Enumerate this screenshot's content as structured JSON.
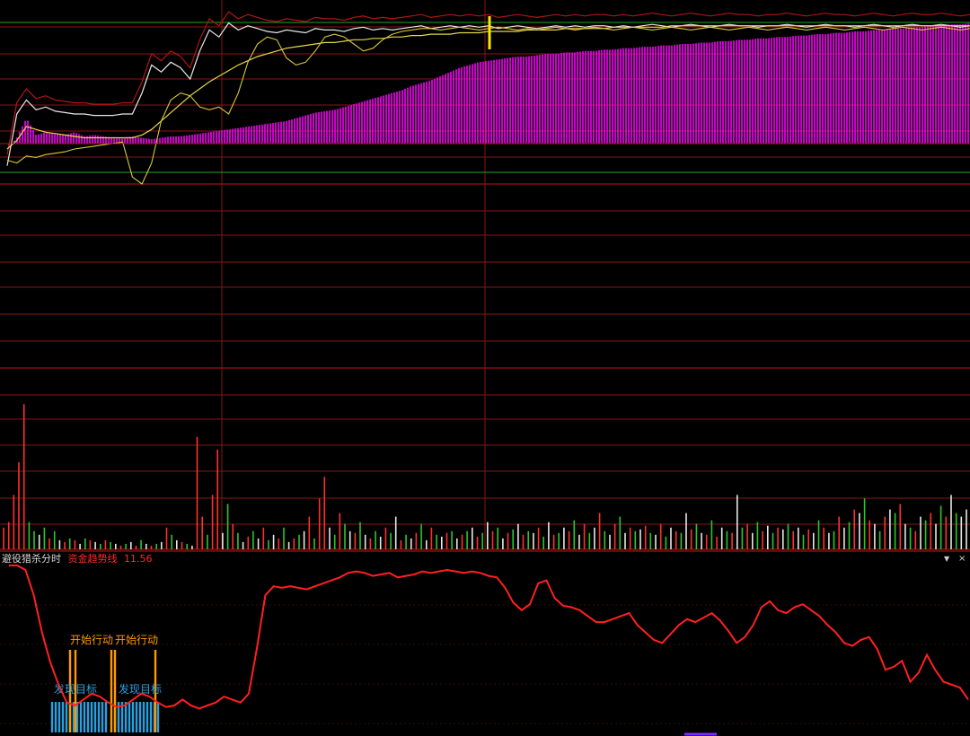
{
  "chart_data": [
    {
      "type": "area",
      "panel": "intraday-price",
      "colors": {
        "area": "#ff00ff",
        "price": "#e8e8e8",
        "avg": "#e6d84a",
        "band": "#b01515",
        "ref_line": "#1fa61f"
      },
      "series": [
        {
          "values": [
            0,
            8,
            22,
            10,
            12,
            11,
            10,
            12,
            9,
            10,
            9,
            8,
            8,
            9,
            8,
            7,
            8,
            9,
            9,
            10,
            11,
            12,
            13,
            14,
            15,
            16,
            17,
            18,
            19,
            20,
            22,
            24,
            26,
            27,
            28,
            30,
            32,
            34,
            36,
            38,
            40,
            42,
            45,
            47,
            49,
            52,
            55,
            58,
            60,
            62,
            63,
            64,
            65,
            66,
            66,
            67,
            68,
            68,
            69,
            69,
            70,
            70,
            71,
            71,
            72,
            72,
            73,
            73,
            74,
            74,
            75,
            75,
            76,
            76,
            77,
            77,
            78,
            78,
            79,
            79,
            80,
            80,
            81,
            81,
            82,
            82,
            83,
            83,
            84,
            84,
            85,
            85,
            86,
            86,
            87,
            87,
            88,
            88,
            89,
            89,
            90
          ]
        },
        {
          "values": [
            -12,
            25,
            35,
            28,
            30,
            27,
            26,
            25,
            25,
            24,
            24,
            24,
            25,
            25,
            40,
            60,
            55,
            62,
            58,
            50,
            70,
            85,
            80,
            90,
            85,
            88,
            86,
            84,
            83,
            85,
            84,
            83,
            86,
            85,
            85,
            84,
            86,
            87,
            85,
            86,
            85,
            86,
            87,
            88,
            86,
            87,
            88,
            87,
            88,
            87,
            88,
            86,
            87,
            88,
            87,
            86,
            87,
            88,
            87,
            88,
            87,
            88,
            88,
            87,
            88,
            87,
            88,
            89,
            88,
            87,
            88,
            89,
            88,
            87,
            88,
            89,
            88,
            88,
            87,
            88,
            88,
            89,
            88,
            87,
            88,
            89,
            88,
            88,
            87,
            88,
            89,
            88,
            87,
            88,
            89,
            88,
            88,
            89,
            88,
            87,
            88
          ]
        },
        {
          "values": [
            0,
            6,
            16,
            14,
            12,
            11,
            10,
            9,
            8,
            8,
            8,
            8,
            8,
            8,
            10,
            14,
            20,
            26,
            32,
            38,
            43,
            48,
            52,
            56,
            60,
            63,
            66,
            68,
            70,
            72,
            73,
            74,
            75,
            76,
            76,
            77,
            78,
            78,
            79,
            79,
            80,
            80,
            81,
            81,
            82,
            82,
            82,
            83,
            83,
            83,
            84,
            84,
            84,
            84,
            85,
            85,
            85,
            85,
            86,
            86,
            86,
            86,
            86,
            87,
            87,
            87,
            87,
            87,
            87,
            88,
            88,
            88,
            88,
            88,
            88,
            88,
            88,
            88,
            88,
            88,
            88,
            88,
            88,
            88,
            88,
            88,
            88,
            88,
            88,
            88,
            88,
            88,
            88,
            88,
            88,
            88,
            88,
            88,
            88,
            88,
            88
          ]
        },
        {
          "values": [
            -8,
            -10,
            -5,
            -6,
            -4,
            -3,
            -2,
            0,
            1,
            2,
            3,
            4,
            5,
            -20,
            -25,
            -10,
            20,
            35,
            40,
            38,
            30,
            28,
            30,
            25,
            40,
            62,
            75,
            80,
            78,
            65,
            60,
            62,
            70,
            80,
            82,
            80,
            75,
            70,
            72,
            78,
            82,
            84,
            85,
            86,
            86,
            85,
            86,
            87,
            86,
            85,
            86,
            87,
            86,
            85,
            86,
            85,
            86,
            87,
            86,
            85,
            86,
            87,
            86,
            85,
            86,
            87,
            86,
            85,
            86,
            87,
            86,
            85,
            86,
            87,
            86,
            85,
            86,
            87,
            86,
            85,
            86,
            87,
            86,
            85,
            86,
            87,
            86,
            85,
            86,
            87,
            86,
            85,
            86,
            87,
            86,
            85,
            86,
            87,
            86,
            85,
            86
          ]
        }
      ]
    },
    {
      "type": "bar",
      "panel": "volume",
      "colors": {
        "up": "#ff3030",
        "down": "#28c828",
        "flat": "#e8e8e8"
      },
      "values": [
        12,
        15,
        30,
        48,
        80,
        15,
        10,
        8,
        12,
        6,
        10,
        5,
        4,
        6,
        5,
        3,
        6,
        5,
        4,
        3,
        5,
        4,
        3,
        2,
        3,
        4,
        2,
        5,
        3,
        2,
        3,
        4,
        12,
        8,
        5,
        4,
        3,
        2,
        62,
        18,
        8,
        30,
        55,
        9,
        25,
        14,
        9,
        4,
        7,
        10,
        6,
        12,
        5,
        8,
        6,
        12,
        4,
        6,
        8,
        10,
        18,
        6,
        28,
        40,
        12,
        8,
        20,
        14,
        10,
        9,
        15,
        8,
        6,
        10,
        7,
        12,
        9,
        18,
        5,
        8,
        6,
        9,
        14,
        5,
        12,
        8,
        7,
        9,
        10,
        6,
        8,
        10,
        12,
        7,
        9,
        15,
        10,
        12,
        6,
        9,
        11,
        14,
        8,
        10,
        9,
        12,
        7,
        15,
        8,
        9,
        12,
        10,
        16,
        8,
        14,
        9,
        12,
        20,
        10,
        8,
        14,
        18,
        9,
        12,
        10,
        11,
        13,
        9,
        8,
        14,
        7,
        12,
        10,
        9,
        20,
        11,
        14,
        9,
        8,
        16,
        7,
        12,
        10,
        9,
        30,
        12,
        14,
        9,
        15,
        10,
        13,
        9,
        12,
        11,
        14,
        10,
        12,
        8,
        11,
        9,
        16,
        12,
        9,
        10,
        18,
        12,
        15,
        22,
        20,
        28,
        16,
        14,
        10,
        18,
        22,
        20,
        25,
        14,
        12,
        10,
        18,
        16,
        20,
        14,
        24,
        18,
        30,
        20,
        18,
        22
      ],
      "direction": [
        1,
        1,
        1,
        1,
        1,
        0,
        0,
        2,
        0,
        1,
        0,
        2,
        1,
        0,
        1,
        2,
        0,
        1,
        2,
        0,
        1,
        0,
        2,
        1,
        0,
        2,
        1,
        0,
        2,
        1,
        0,
        2,
        1,
        0,
        2,
        1,
        0,
        2,
        1,
        1,
        0,
        1,
        1,
        2,
        0,
        1,
        0,
        2,
        1,
        0,
        2,
        1,
        0,
        2,
        1,
        0,
        2,
        1,
        0,
        2,
        1,
        0,
        1,
        1,
        2,
        0,
        1,
        0,
        2,
        1,
        0,
        2,
        1,
        0,
        2,
        1,
        0,
        2,
        1,
        0,
        2,
        1,
        0,
        2,
        1,
        0,
        2,
        1,
        0,
        2,
        1,
        0,
        2,
        1,
        0,
        2,
        1,
        0,
        2,
        1,
        0,
        2,
        1,
        0,
        2,
        1,
        0,
        2,
        1,
        0,
        2,
        1,
        0,
        2,
        1,
        0,
        2,
        1,
        0,
        2,
        1,
        0,
        2,
        1,
        0,
        2,
        1,
        0,
        2,
        1,
        0,
        2,
        1,
        0,
        2,
        1,
        0,
        2,
        1,
        0,
        1,
        2,
        0,
        1,
        2,
        0,
        1,
        2,
        0,
        1,
        2,
        0,
        1,
        2,
        0,
        1,
        2,
        0,
        1,
        2,
        0,
        1,
        2,
        0,
        1,
        2,
        0,
        1,
        2,
        0,
        1,
        2,
        0,
        1,
        2,
        0,
        1,
        2,
        0,
        1,
        2,
        0,
        1,
        2,
        0,
        1,
        2,
        0
      ]
    },
    {
      "type": "line",
      "panel": "indicator",
      "name": "避役猎杀分时",
      "series": [
        {
          "name": "资金趋势线",
          "color": "#ff2020",
          "values": [
            100,
            100,
            97,
            80,
            55,
            35,
            20,
            8,
            6,
            10,
            14,
            12,
            8,
            5,
            6,
            10,
            14,
            12,
            8,
            5,
            6,
            10,
            6,
            4,
            6,
            8,
            12,
            10,
            8,
            14,
            45,
            80,
            86,
            85,
            86,
            85,
            84,
            86,
            88,
            90,
            92,
            95,
            96,
            95,
            93,
            94,
            95,
            92,
            93,
            94,
            96,
            95,
            96,
            97,
            96,
            95,
            96,
            95,
            93,
            92,
            85,
            75,
            70,
            74,
            88,
            90,
            78,
            73,
            72,
            70,
            66,
            62,
            62,
            64,
            66,
            68,
            60,
            55,
            50,
            48,
            54,
            60,
            64,
            62,
            65,
            68,
            63,
            56,
            48,
            52,
            60,
            72,
            76,
            70,
            68,
            72,
            74,
            70,
            66,
            60,
            55,
            48,
            46,
            50,
            52,
            44,
            30,
            32,
            36,
            22,
            28,
            40,
            30,
            22,
            20,
            18,
            10
          ]
        }
      ],
      "labels": {
        "start_action": "开始行动",
        "find_target": "发现目标"
      },
      "marker_colors": {
        "start_action": "#ff9a00",
        "find_target": "#2aa0e0"
      }
    }
  ],
  "indicator_header": {
    "name": "避役猎杀分时",
    "series_name": "资金趋势线",
    "value": "11.56"
  },
  "window_controls": {
    "menu_icon": "triangle-down-icon",
    "close_icon": "close-icon",
    "menu_glyph": "▼",
    "close_glyph": "×"
  }
}
